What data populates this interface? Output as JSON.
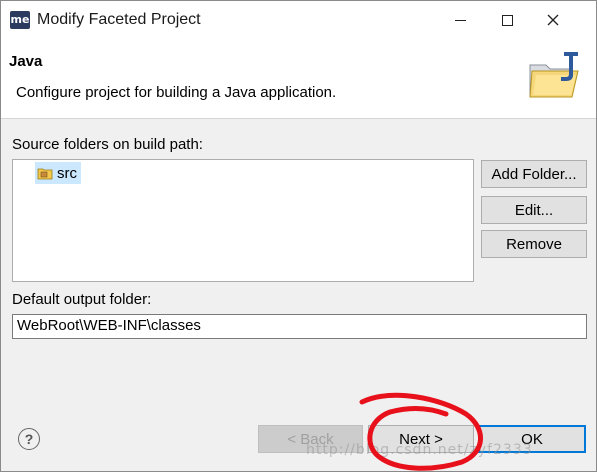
{
  "window": {
    "app_icon_text": "me",
    "title": "Modify Faceted Project",
    "controls": {
      "minimize": "minimize-icon",
      "maximize": "maximize-icon",
      "close": "close-icon"
    }
  },
  "header": {
    "title": "Java",
    "description": "Configure project for building a Java application.",
    "icon": "java-folder-icon"
  },
  "source": {
    "label": "Source folders on build path:",
    "items": [
      {
        "label": "src",
        "icon": "package-folder-icon",
        "selected": true
      }
    ],
    "buttons": {
      "add": "Add Folder...",
      "edit": "Edit...",
      "remove": "Remove"
    }
  },
  "output": {
    "label": "Default output folder:",
    "value": "WebRoot\\WEB-INF\\classes"
  },
  "footer": {
    "help": "?",
    "back": "< Back",
    "next": "Next >",
    "ok": "OK",
    "watermark": "http://blog.csdn.net/zyf2333"
  },
  "colors": {
    "annotation": "#e8111b",
    "selection": "#cce8ff",
    "default_button_border": "#0078d7"
  }
}
